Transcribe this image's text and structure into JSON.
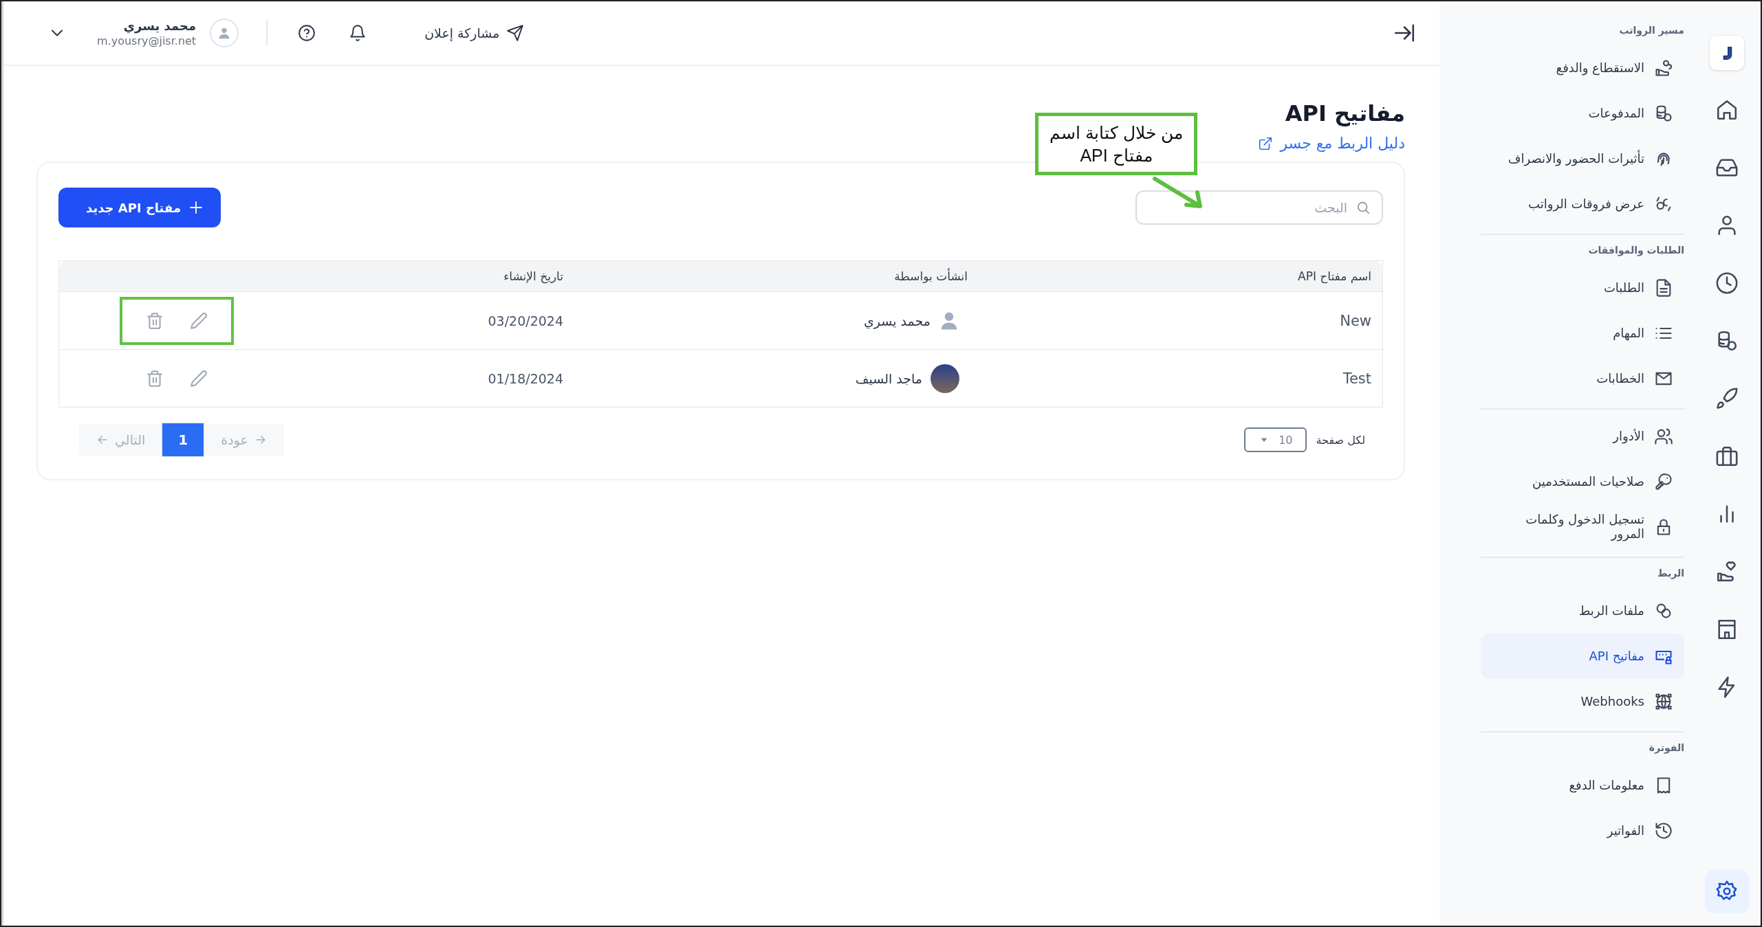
{
  "top_bar": {
    "announcement": "مشاركة إعلان",
    "user_name": "محمد يسري",
    "user_email": "m.yousry@jisr.net"
  },
  "page": {
    "title": "مفاتيح API",
    "guide_link": "دليل الربط مع جسر"
  },
  "annotation": {
    "text": "من خلال كتابة اسم مفتاح API"
  },
  "search": {
    "placeholder": "البحث"
  },
  "new_button": "مفتاح API جديد",
  "table": {
    "columns": [
      "اسم مفتاح API",
      "انشأت بواسطة",
      "تاريخ الإنشاء"
    ],
    "rows": [
      {
        "name": "New",
        "created_by": "محمد يسري",
        "kind": "silhouette",
        "created_at": "03/20/2024",
        "highlighted": true
      },
      {
        "name": "Test",
        "created_by": "ماجد السيف",
        "kind": "photo",
        "created_at": "01/18/2024",
        "highlighted": false
      }
    ]
  },
  "pagination": {
    "per_page_label": "لكل صفحة",
    "per_page": "10",
    "back": {
      "label": "عودة",
      "disabled": true
    },
    "next": {
      "label": "التالي",
      "disabled": true
    },
    "pages": [
      {
        "label": "1",
        "selected": true
      }
    ]
  },
  "sidebar": {
    "sections": [
      {
        "title": "مسير الرواتب",
        "items": [
          {
            "label": "الاستقطاع والدفع",
            "selected": false
          },
          {
            "label": "المدفوعات",
            "selected": false
          },
          {
            "label": "تأثيرات الحضور والانصراف",
            "selected": false
          },
          {
            "label": "عرض فروقات الرواتب",
            "selected": false
          }
        ]
      },
      {
        "title": "الطلبات والموافقات",
        "items": [
          {
            "label": "الطلبات",
            "selected": false
          },
          {
            "label": "المهام",
            "selected": false
          },
          {
            "label": "الخطابات",
            "selected": false
          }
        ]
      },
      {
        "items": [
          {
            "label": "الأدوار",
            "selected": false
          },
          {
            "label": "صلاحيات المستخدمين",
            "selected": false
          },
          {
            "label": "تسجيل الدخول وكلمات المرور",
            "selected": false
          }
        ]
      },
      {
        "title": "الربط",
        "items": [
          {
            "label": "ملفات الربط",
            "selected": false
          },
          {
            "label": "مفاتيح API",
            "selected": true
          },
          {
            "label": "Webhooks",
            "selected": false
          }
        ]
      },
      {
        "title": "الفوترة",
        "items": [
          {
            "label": "معلومات الدفع",
            "selected": false
          },
          {
            "label": "الفواتير",
            "selected": false
          }
        ]
      }
    ]
  },
  "rail": [
    {
      "selected": false
    },
    {
      "selected": false
    },
    {
      "selected": false
    },
    {
      "selected": false
    },
    {
      "selected": false
    },
    {
      "selected": false
    },
    {
      "selected": false
    },
    {
      "selected": false
    },
    {
      "selected": false
    },
    {
      "selected": false
    },
    {
      "selected": false
    },
    {
      "selected": true
    }
  ]
}
